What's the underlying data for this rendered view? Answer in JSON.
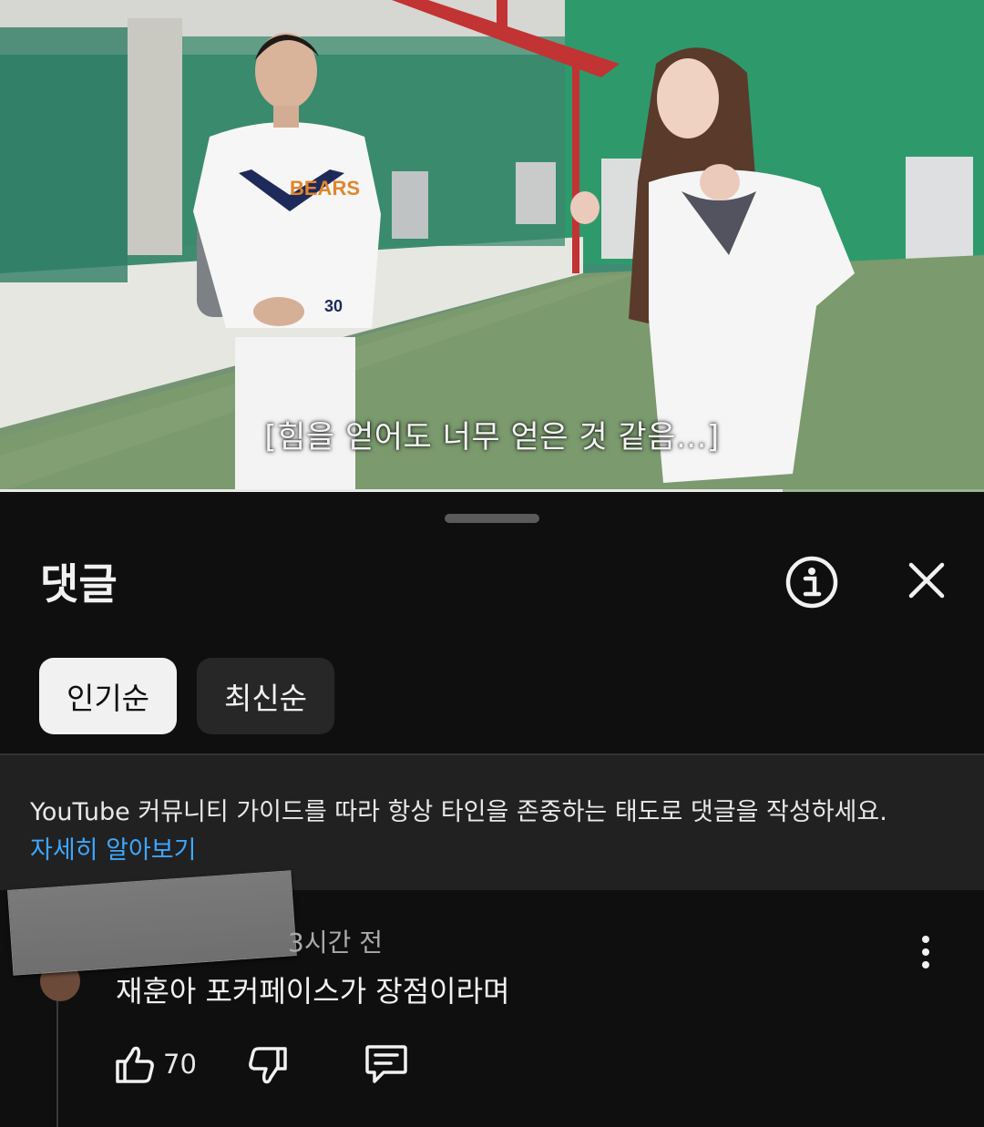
{
  "video": {
    "subtitle": "[힘을 얻어도 너무 얻은 것 같음...]",
    "progress_fraction": 0.795,
    "jersey_text": "BEARS",
    "jersey_number": "30"
  },
  "comments_panel": {
    "title": "댓글",
    "info_icon": "info-icon",
    "close_icon": "close-icon",
    "sort_chips": [
      {
        "label": "인기순",
        "selected": true
      },
      {
        "label": "최신순",
        "selected": false
      }
    ],
    "guideline": {
      "text": "YouTube 커뮤니티 가이드를 따라 항상 타인을 존중하는 태도로 댓글을 작성하세요.",
      "link": "자세히 알아보기"
    }
  },
  "comment": {
    "author_redacted": true,
    "time": "3시간 전",
    "text": "재훈아 포커페이스가 장점이라며",
    "like_count": "70"
  },
  "colors": {
    "background": "#0f0f0f",
    "guide_bg": "#212121",
    "link": "#3ea6ff",
    "chip_active_bg": "#f1f1f1",
    "chip_idle_bg": "#272727"
  }
}
